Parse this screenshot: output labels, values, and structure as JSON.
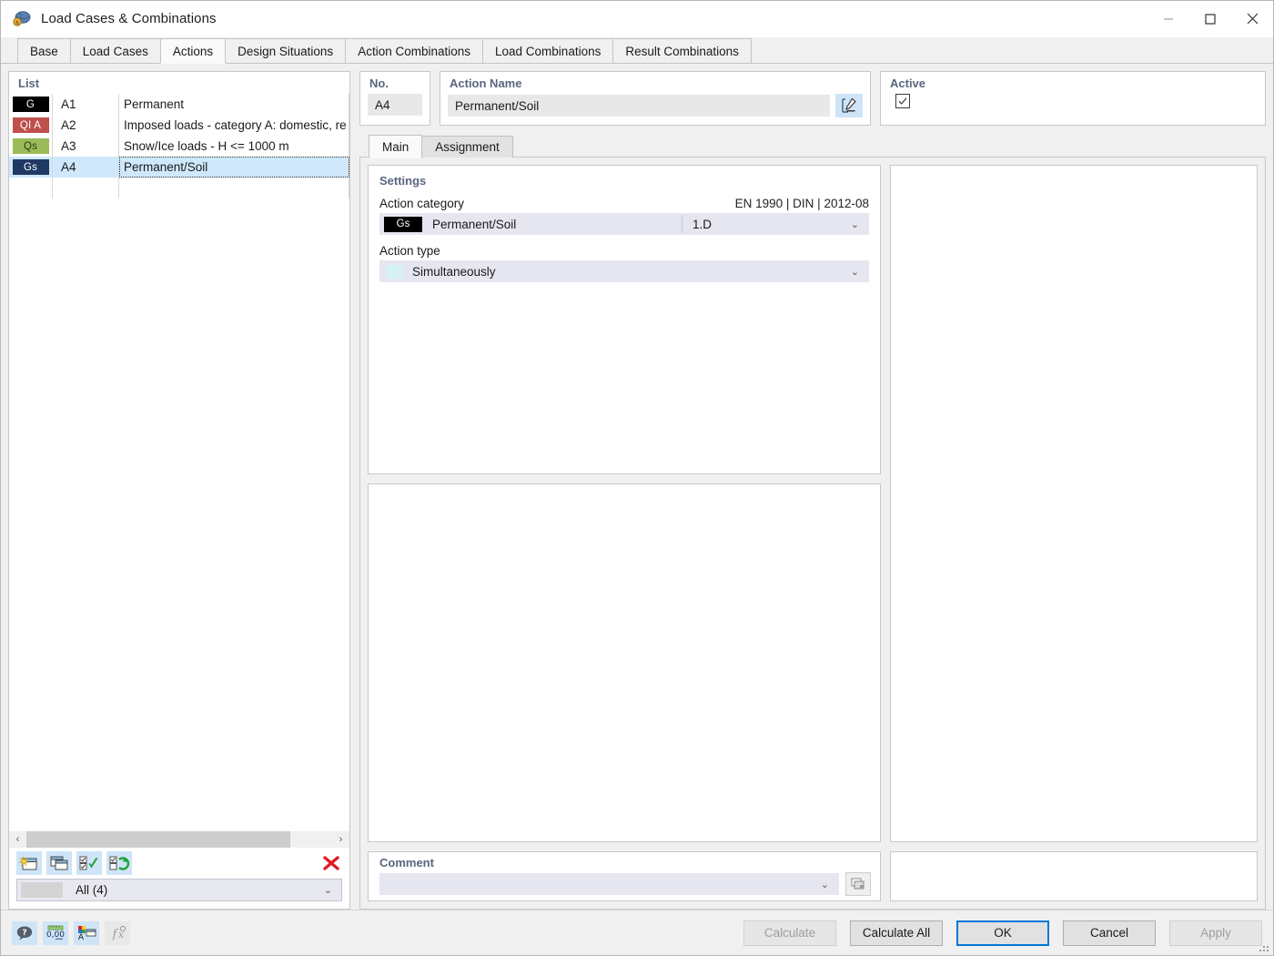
{
  "window": {
    "title": "Load Cases & Combinations",
    "icon": "app-icon",
    "controls": {
      "minimize": "—",
      "maximize": "▢",
      "close": "✕"
    }
  },
  "tabs": [
    {
      "label": "Base",
      "active": false
    },
    {
      "label": "Load Cases",
      "active": false
    },
    {
      "label": "Actions",
      "active": true
    },
    {
      "label": "Design Situations",
      "active": false
    },
    {
      "label": "Action Combinations",
      "active": false
    },
    {
      "label": "Load Combinations",
      "active": false
    },
    {
      "label": "Result Combinations",
      "active": false
    }
  ],
  "list": {
    "title": "List",
    "rows": [
      {
        "badge": "G",
        "badge_color": "#000000",
        "no": "A1",
        "description": "Permanent",
        "selected": false
      },
      {
        "badge": "QI A",
        "badge_color": "#c0504d",
        "no": "A2",
        "description": "Imposed loads - category A: domestic, re",
        "selected": false
      },
      {
        "badge": "Qs",
        "badge_color": "#9bbb59",
        "no": "A3",
        "description": "Snow/Ice loads - H <= 1000 m",
        "selected": false
      },
      {
        "badge": "Gs",
        "badge_color": "#1f3864",
        "no": "A4",
        "description": "Permanent/Soil",
        "selected": true
      }
    ],
    "scroll": {
      "left_arrow": "‹",
      "right_arrow": "›"
    },
    "toolbar": [
      {
        "name": "new-action-button",
        "icon": "new-window-icon"
      },
      {
        "name": "copy-action-button",
        "icon": "copy-window-icon"
      },
      {
        "name": "select-all-button",
        "icon": "checkbox-check-icon"
      },
      {
        "name": "invert-selection-button",
        "icon": "checkbox-refresh-icon"
      },
      {
        "name": "delete-action-button",
        "icon": "red-x-icon"
      }
    ],
    "filter": {
      "label": "All (4)",
      "caret": "⌄"
    }
  },
  "details": {
    "no": {
      "title": "No.",
      "value": "A4"
    },
    "action_name": {
      "title": "Action Name",
      "value": "Permanent/Soil",
      "edit_icon": "edit-pencil-icon"
    },
    "active": {
      "title": "Active",
      "checked": true,
      "check_glyph": "✓"
    },
    "subtabs": [
      {
        "label": "Main",
        "active": true
      },
      {
        "label": "Assignment",
        "active": false
      }
    ],
    "settings": {
      "title": "Settings",
      "action_category": {
        "label": "Action category",
        "standard": "EN 1990 | DIN | 2012-08",
        "badge": "Gs",
        "badge_color": "#000000",
        "value": "Permanent/Soil",
        "code": "1.D",
        "caret": "⌄"
      },
      "action_type": {
        "label": "Action type",
        "value": "Simultaneously",
        "swatch_color": "#d5f2f7",
        "caret": "⌄"
      }
    },
    "comment": {
      "title": "Comment",
      "value": "",
      "caret": "⌄",
      "copy_icon": "copy-icon"
    }
  },
  "footer": {
    "tools": [
      {
        "name": "help-button",
        "icon": "help-bubble-icon",
        "disabled": false
      },
      {
        "name": "units-button",
        "icon": "units-0-00-icon",
        "disabled": false
      },
      {
        "name": "colors-button",
        "icon": "color-palette-icon",
        "disabled": false
      },
      {
        "name": "formula-button",
        "icon": "fx-icon",
        "disabled": true
      }
    ],
    "buttons": [
      {
        "label": "Calculate",
        "state": "disabled"
      },
      {
        "label": "Calculate All",
        "state": "normal"
      },
      {
        "label": "OK",
        "state": "default"
      },
      {
        "label": "Cancel",
        "state": "normal"
      },
      {
        "label": "Apply",
        "state": "disabled"
      }
    ]
  }
}
